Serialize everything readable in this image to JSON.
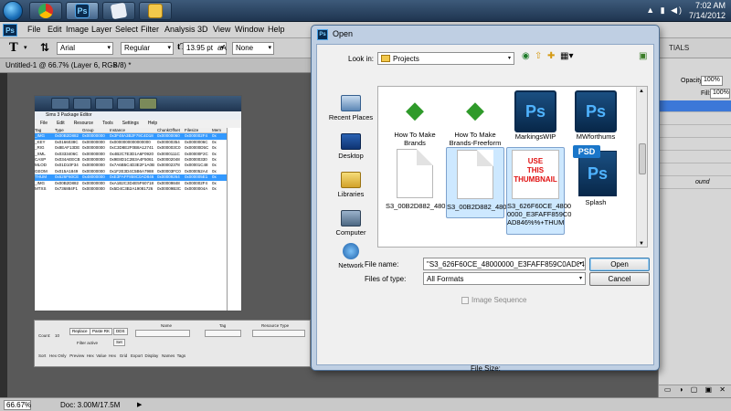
{
  "taskbar": {
    "buttons": [
      "chrome",
      "photoshop",
      "notes",
      "explorer"
    ],
    "time": "7:02 AM",
    "date": "7/14/2012"
  },
  "photoshop": {
    "logo": "Ps",
    "menu": [
      "File",
      "Edit",
      "Image",
      "Layer",
      "Select",
      "Filter",
      "Analysis",
      "3D",
      "View",
      "Window",
      "Help"
    ],
    "options": {
      "font": "Arial",
      "style": "Regular",
      "size": "13.95 pt",
      "aa_icon": "aA",
      "aa": "None",
      "workspace": "TIALS"
    },
    "doc_tab": "Untitled-1 @ 66.7% (Layer 6, RGB/8) *",
    "status": {
      "zoom": "66.67%",
      "doc": "Doc: 3.00M/17.5M"
    },
    "panels": {
      "opacity_label": "Opacity:",
      "opacity_value": "100%",
      "fill_label": "Fill:",
      "fill_value": "100%",
      "layer_text": "ound"
    }
  },
  "inner_app": {
    "title": "Sims 3 Package Editor",
    "menu": [
      "File",
      "Edit",
      "Resource",
      "Tools",
      "Settings",
      "Help"
    ],
    "headers": [
      "Tag",
      "Type",
      "Group",
      "Instance",
      "ChunkOffset",
      "Filesize",
      "Mem"
    ],
    "rows": [
      [
        "_IMG",
        "0x00B2D882",
        "0x00000000",
        "0x3F48A3B2F79C4D18",
        "0x00000060",
        "0x000002F4",
        "0x"
      ],
      [
        "_KEY",
        "0x0166038C",
        "0x00000000",
        "0x0000000000000000",
        "0x00000354",
        "0x0000006C",
        "0x"
      ],
      [
        "_RIG",
        "0x8EAF13DE",
        "0x00000000",
        "0xC3D8E2F0B8A12741",
        "0x000003C0",
        "0x00000D5C",
        "0x"
      ],
      [
        "_XML",
        "0x0333406C",
        "0x00000000",
        "0x4B2C7E3D1A6F0920",
        "0x0000111C",
        "0x00000F2C",
        "0x"
      ],
      [
        "CASP",
        "0x034AEECB",
        "0x00000000",
        "0x9E8D1C2B3A4F5061",
        "0x00002048",
        "0x00000330",
        "0x"
      ],
      [
        "MLOD",
        "0x01D10F34",
        "0x00000000",
        "0x7A6B5C4D3E2F1A0B",
        "0x00002378",
        "0x00001C48",
        "0x"
      ],
      [
        "GEOM",
        "0x015A1849",
        "0x00000000",
        "0x1F2E3D4C5B6A7988",
        "0x00003FC0",
        "0x000052A4",
        "0x"
      ],
      [
        "THUM",
        "0x626F60CE",
        "0x48000000",
        "0xE3FAFF859C0AD846",
        "0x00009264",
        "0x000005E1",
        "0x"
      ],
      [
        "_IMG",
        "0x00B2D882",
        "0x00000000",
        "0xA1B2C3D4E5F60718",
        "0x00009848",
        "0x000002F4",
        "0x"
      ],
      [
        "MTXS",
        "0x736884F1",
        "0x00000000",
        "0x5D4C3B2A19081726",
        "0x00009B3C",
        "0x0000004A",
        "0x"
      ]
    ],
    "bottom": {
      "count_label": "Count:",
      "count_value": "10",
      "btn_replace": "Replace",
      "btn_paste_rk": "Paste RK",
      "btn_dds": "DDS",
      "filter_label": "Filter active",
      "btn_set": "Set",
      "name_label": "Name",
      "tag_label": "Tag",
      "restype_label": "Resource Type",
      "row_labels": "Sort   Hex Only   Preview  Hex  Value  Hex   Grid   Export  Display   Names  Tags"
    }
  },
  "dialog": {
    "title": "Open",
    "ps_icon": "Ps",
    "look_in_label": "Look in:",
    "look_in_value": "Projects",
    "places": [
      "Recent Places",
      "Desktop",
      "Libraries",
      "Computer",
      "Network"
    ],
    "files": [
      {
        "name": "How To Make\nBrands",
        "kind": "sims"
      },
      {
        "name": "How To Make\nBrands-Freeform",
        "kind": "sims"
      },
      {
        "name": "MarkingsWIP",
        "kind": "ps"
      },
      {
        "name": "MWforthums",
        "kind": "ps"
      },
      {
        "name": "S3_00B2D882_480...",
        "kind": "blank"
      },
      {
        "name": "S3_00B2D882_480...",
        "kind": "blank"
      },
      {
        "name": "S3_626F60CE_4800\n0000_E3FAFF859C0\nAD846%%+THUM",
        "kind": "red"
      },
      {
        "name": "Splash",
        "kind": "psd"
      }
    ],
    "red_thumb_text": "USE\nTHIS\nTHUMBNAIL",
    "psd_tag": "PSD",
    "file_name_label": "File name:",
    "file_name_value": "\"S3_626F60CE_48000000_E3FAFF859C0AD846%%+THUM",
    "files_of_type_label": "Files of type:",
    "files_of_type_value": "All Formats",
    "image_sequence_label": "Image Sequence",
    "open_button": "Open",
    "cancel_button": "Cancel",
    "file_size_label": "File Size:"
  }
}
